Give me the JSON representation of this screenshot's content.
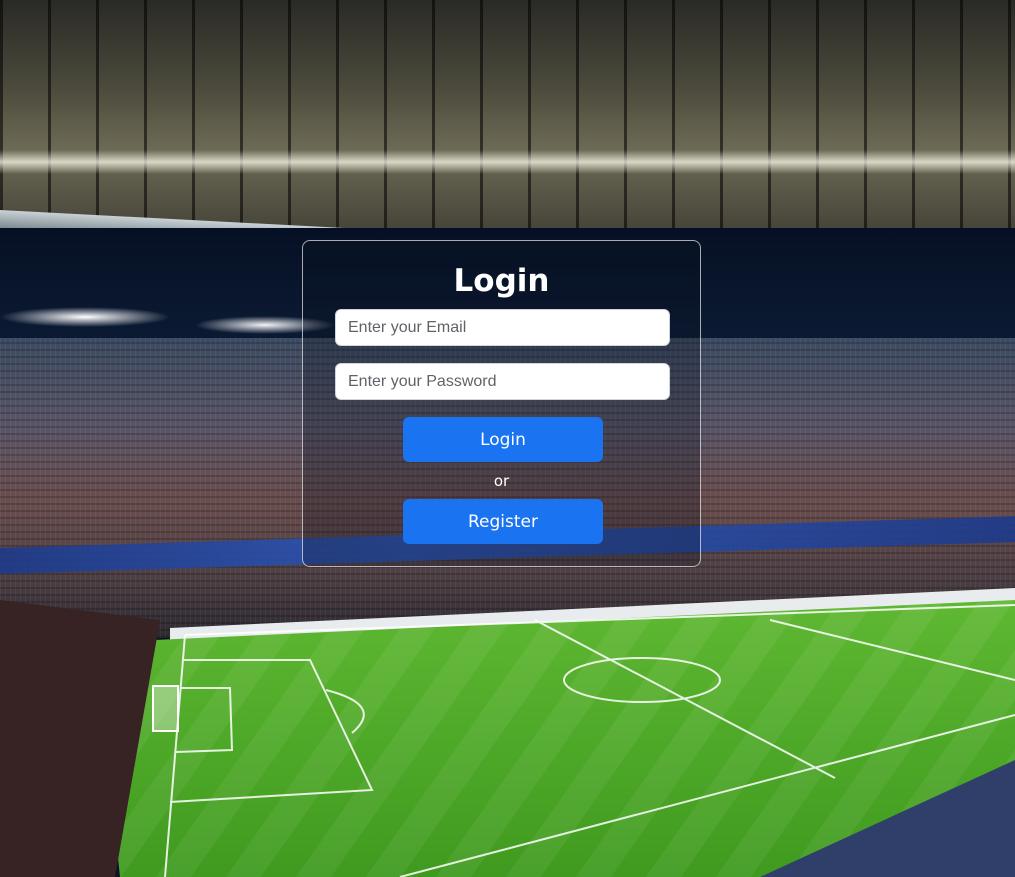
{
  "login": {
    "title": "Login",
    "email_placeholder": "Enter your Email",
    "password_placeholder": "Enter your Password",
    "login_button_label": "Login",
    "or_text": "or",
    "register_button_label": "Register"
  },
  "colors": {
    "primary_button": "#1a73f0",
    "card_border": "#ffffff",
    "title_text": "#ffffff"
  },
  "background": {
    "subject": "football-stadium-at-night",
    "decorative": true
  }
}
